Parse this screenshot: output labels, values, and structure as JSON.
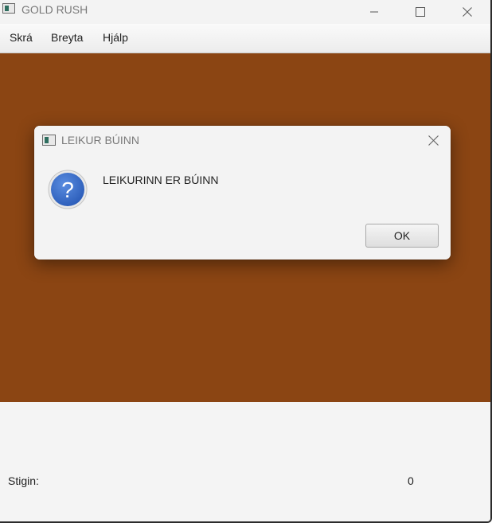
{
  "window": {
    "title": "GOLD RUSH",
    "icon": "app-window-icon",
    "controls": [
      "minimize-icon",
      "maximize-icon",
      "close-icon"
    ]
  },
  "menubar": {
    "items": [
      {
        "label": "Skrá"
      },
      {
        "label": "Breyta"
      },
      {
        "label": "Hjálp"
      }
    ]
  },
  "game": {
    "background_color": "#8b4513"
  },
  "status": {
    "score_label": "Stigin:",
    "score_value": "0"
  },
  "dialog": {
    "title": "LEIKUR BÚINN",
    "icon": "question-icon",
    "message": "LEIKURINN ER BÚINN",
    "ok_label": "OK",
    "accent_color": "#2f63c2"
  }
}
